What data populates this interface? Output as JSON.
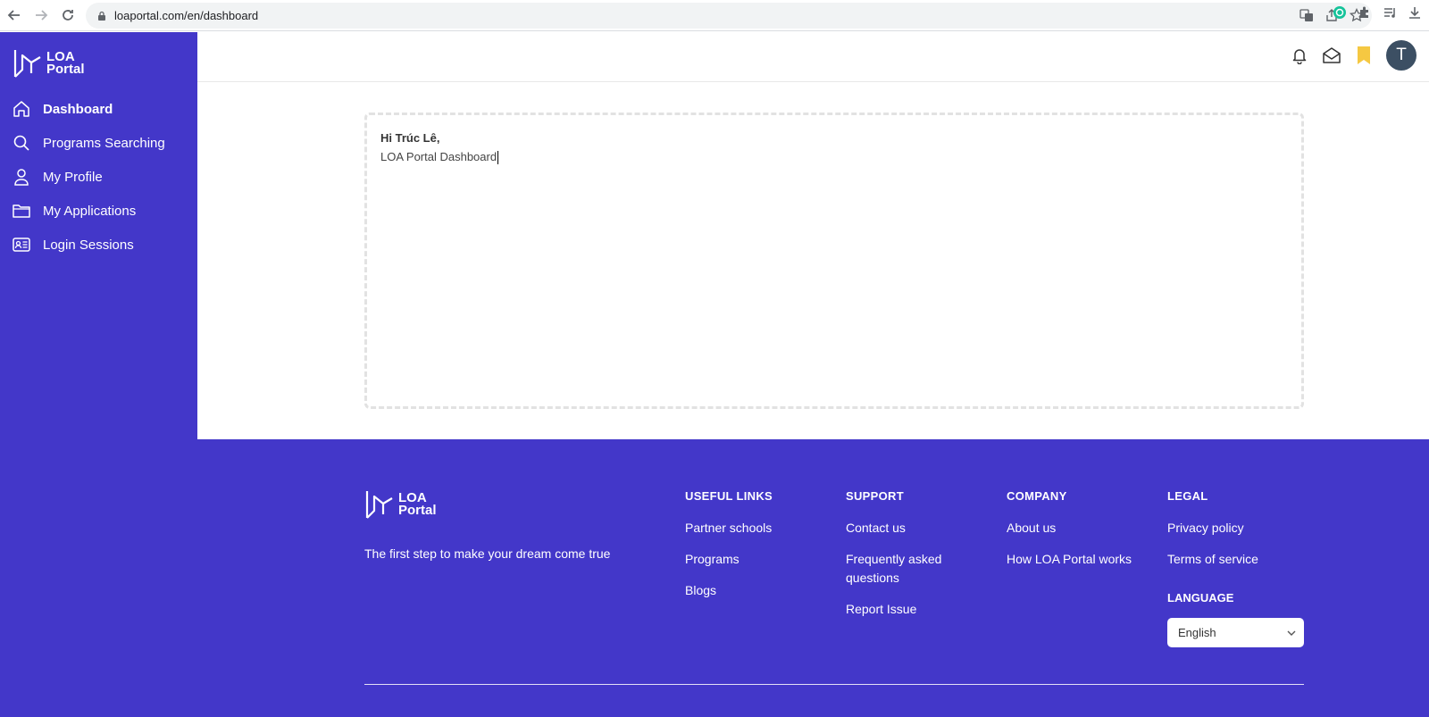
{
  "browser": {
    "url": "loaportal.com/en/dashboard"
  },
  "logo": {
    "line1": "LOA",
    "line2": "Portal"
  },
  "sidebar": {
    "items": [
      {
        "label": "Dashboard",
        "icon": "home-icon",
        "active": true
      },
      {
        "label": "Programs Searching",
        "icon": "search-icon",
        "active": false
      },
      {
        "label": "My Profile",
        "icon": "user-icon",
        "active": false
      },
      {
        "label": "My Applications",
        "icon": "folder-icon",
        "active": false
      },
      {
        "label": "Login Sessions",
        "icon": "id-card-icon",
        "active": false
      }
    ]
  },
  "header": {
    "avatar_initial": "T",
    "icons": [
      "bell-icon",
      "envelope-icon",
      "bookmark-icon"
    ]
  },
  "main": {
    "greeting": "Hi Trúc Lê,",
    "subtitle": "LOA Portal Dashboard"
  },
  "footer": {
    "tagline": "The first step to make your dream come true",
    "useful_links": {
      "title": "USEFUL LINKS",
      "links": [
        "Partner schools",
        "Programs",
        "Blogs"
      ]
    },
    "support": {
      "title": "SUPPORT",
      "links": [
        "Contact us",
        "Frequently asked questions",
        "Report Issue"
      ]
    },
    "company": {
      "title": "COMPANY",
      "links": [
        "About us",
        "How LOA Portal works"
      ]
    },
    "legal": {
      "title": "LEGAL",
      "links": [
        "Privacy policy",
        "Terms of service"
      ]
    },
    "language": {
      "title": "LANGUAGE",
      "selected": "English"
    }
  },
  "colors": {
    "brand_primary": "#4337c9",
    "bookmark": "#f5c842",
    "avatar_bg": "#3c4f63"
  }
}
